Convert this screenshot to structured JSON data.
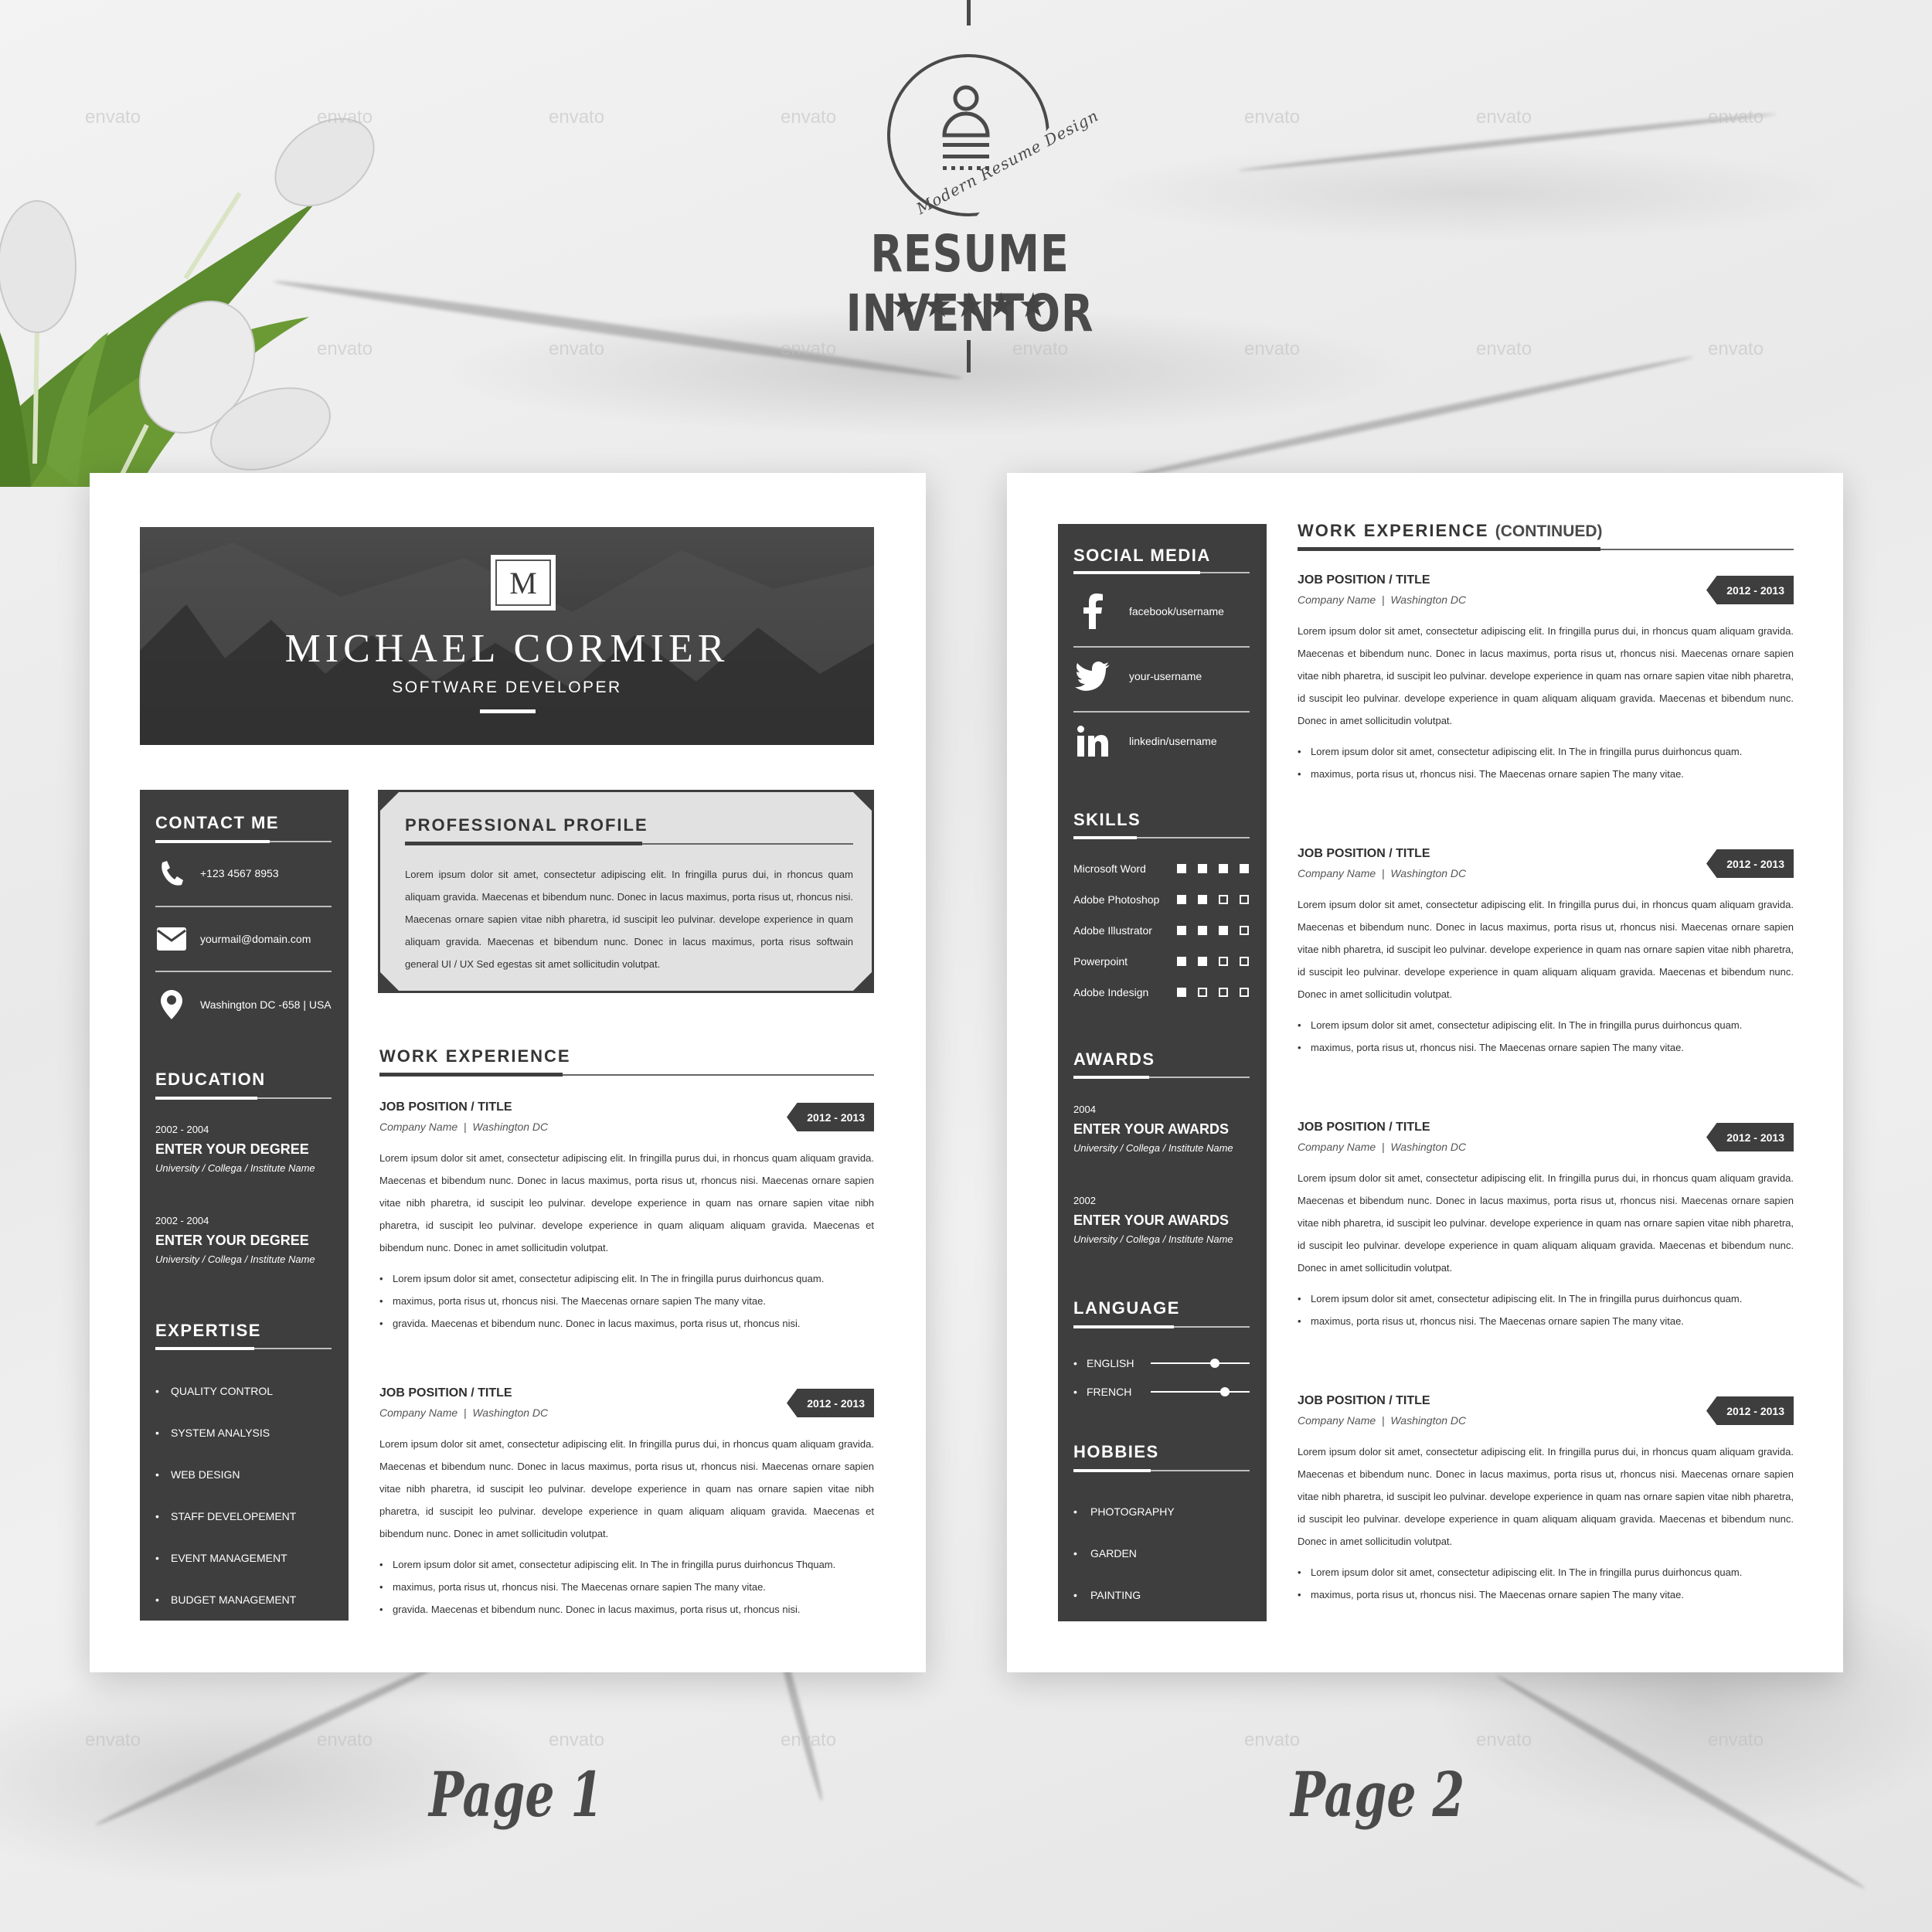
{
  "brand": {
    "tagline": "Modern Resume Design",
    "title": "RESUME INVENTOR",
    "rating_stars": 5,
    "stars_text": "★★★★★"
  },
  "watermark": "envato",
  "page1": {
    "header": {
      "monogram": "M",
      "name": "MICHAEL CORMIER",
      "role": "SOFTWARE DEVELOPER"
    },
    "contact": {
      "title": "CONTACT ME",
      "phone": "+123 4567 8953",
      "email": "yourmail@domain.com",
      "address": "Washington DC -658 | USA"
    },
    "education": {
      "title": "EDUCATION",
      "items": [
        {
          "years": "2002 - 2004",
          "degree": "ENTER YOUR DEGREE",
          "institution": "University / Collega / Institute Name"
        },
        {
          "years": "2002 - 2004",
          "degree": "ENTER YOUR DEGREE",
          "institution": "University / Collega / Institute Name"
        }
      ]
    },
    "expertise": {
      "title": "EXPERTISE",
      "items": [
        "QUALITY CONTROL",
        "SYSTEM ANALYSIS",
        "WEB DESIGN",
        "STAFF DEVELOPEMENT",
        "EVENT MANAGEMENT",
        "BUDGET MANAGEMENT"
      ]
    },
    "profile": {
      "title": "PROFESSIONAL PROFILE",
      "text": "Lorem ipsum dolor sit amet, consectetur adipiscing elit. In fringilla purus dui, in rhoncus quam aliquam gravida. Maecenas et bibendum nunc. Donec in lacus maximus, porta risus ut, rhoncus nisi. Maecenas ornare sapien vitae nibh pharetra, id suscipit leo pulvinar. develope experience in quam aliquam gravida. Maecenas et bibendum nunc. Donec in lacus maximus, porta risus softwain general UI / UX Sed egestas sit amet sollicitudin volutpat."
    },
    "work": {
      "title": "WORK EXPERIENCE",
      "jobs": [
        {
          "title": "JOB POSITION / TITLE",
          "company": "Company Name  |  Washington DC",
          "dates": "2012 - 2013",
          "description": "Lorem ipsum dolor sit amet, consectetur adipiscing elit. In fringilla purus dui, in rhoncus quam aliquam gravida. Maecenas et bibendum nunc. Donec in lacus maximus, porta risus ut, rhoncus nisi. Maecenas ornare sapien vitae nibh pharetra, id suscipit leo pulvinar. develope experience in quam nas ornare sapien vitae nibh pharetra, id suscipit leo pulvinar. develope experience in quam aliquam aliquam gravida. Maecenas et bibendum nunc. Donec in amet sollicitudin volutpat.",
          "bullets": [
            "Lorem ipsum dolor sit amet, consectetur adipiscing elit. In The in fringilla purus duirhoncus quam.",
            "maximus, porta risus ut, rhoncus nisi. The Maecenas ornare sapien The many vitae.",
            "gravida. Maecenas et bibendum nunc. Donec in lacus maximus, porta risus ut, rhoncus nisi."
          ]
        },
        {
          "title": "JOB POSITION / TITLE",
          "company": "Company Name  |  Washington DC",
          "dates": "2012 - 2013",
          "description": "Lorem ipsum dolor sit amet, consectetur adipiscing elit. In fringilla purus dui, in rhoncus quam aliquam gravida. Maecenas et bibendum nunc. Donec in lacus maximus, porta risus ut, rhoncus nisi. Maecenas ornare sapien vitae nibh pharetra, id suscipit leo pulvinar. develope experience in quam nas ornare sapien vitae nibh pharetra, id suscipit leo pulvinar. develope experience in quam aliquam aliquam gravida. Maecenas et bibendum nunc. Donec in amet sollicitudin volutpat.",
          "bullets": [
            "Lorem ipsum dolor sit amet, consectetur adipiscing elit. In The in fringilla purus duirhoncus Thquam.",
            "maximus, porta risus ut, rhoncus nisi. The Maecenas ornare sapien The many vitae.",
            "gravida. Maecenas et bibendum nunc. Donec in lacus maximus, porta risus ut, rhoncus nisi."
          ]
        }
      ]
    },
    "caption": "Page 1"
  },
  "page2": {
    "social": {
      "title": "SOCIAL MEDIA",
      "items": [
        {
          "icon": "facebook-icon",
          "label": "facebook/username"
        },
        {
          "icon": "twitter-icon",
          "label": "your-username"
        },
        {
          "icon": "linkedin-icon",
          "label": "linkedin/username"
        }
      ]
    },
    "skills": {
      "title": "SKILLS",
      "max": 4,
      "items": [
        {
          "name": "Microsoft Word",
          "level": 4
        },
        {
          "name": "Adobe Photoshop",
          "level": 2
        },
        {
          "name": "Adobe Illustrator",
          "level": 3
        },
        {
          "name": "Powerpoint",
          "level": 2
        },
        {
          "name": "Adobe Indesign",
          "level": 1
        }
      ]
    },
    "awards": {
      "title": "AWARDS",
      "items": [
        {
          "year": "2004",
          "name": "ENTER YOUR AWARDS",
          "institution": "University / Collega / Institute Name"
        },
        {
          "year": "2002",
          "name": "ENTER YOUR AWARDS",
          "institution": "University / Collega / Institute Name"
        }
      ]
    },
    "language": {
      "title": "LANGUAGE",
      "items": [
        {
          "name": "ENGLISH",
          "proficiency": 0.65
        },
        {
          "name": "FRENCH",
          "proficiency": 0.75
        }
      ]
    },
    "hobbies": {
      "title": "HOBBIES",
      "items": [
        "PHOTOGRAPHY",
        "GARDEN",
        "PAINTING"
      ]
    },
    "work": {
      "title": "WORK EXPERIENCE",
      "title_suffix": "(CONTINUED)",
      "jobs": [
        {
          "title": "JOB POSITION / TITLE",
          "company": "Company Name  |  Washington DC",
          "dates": "2012 - 2013",
          "description": "Lorem ipsum dolor sit amet, consectetur adipiscing elit. In fringilla purus dui, in rhoncus quam aliquam gravida. Maecenas et bibendum nunc. Donec in lacus maximus, porta risus ut, rhoncus nisi. Maecenas ornare sapien vitae nibh pharetra, id suscipit leo pulvinar. develope experience in quam nas ornare sapien vitae nibh pharetra, id suscipit leo pulvinar. develope experience in quam aliquam aliquam gravida. Maecenas et bibendum nunc. Donec in amet sollicitudin volutpat.",
          "bullets": [
            "Lorem ipsum dolor sit amet, consectetur adipiscing elit. In The in fringilla purus duirhoncus quam.",
            "maximus, porta risus ut, rhoncus nisi. The Maecenas ornare sapien The many vitae."
          ]
        },
        {
          "title": "JOB POSITION / TITLE",
          "company": "Company Name  |  Washington DC",
          "dates": "2012 - 2013",
          "description": "Lorem ipsum dolor sit amet, consectetur adipiscing elit. In fringilla purus dui, in rhoncus quam aliquam gravida. Maecenas et bibendum nunc. Donec in lacus maximus, porta risus ut, rhoncus nisi. Maecenas ornare sapien vitae nibh pharetra, id suscipit leo pulvinar. develope experience in quam nas ornare sapien vitae nibh pharetra, id suscipit leo pulvinar. develope experience in quam aliquam aliquam gravida. Maecenas et bibendum nunc. Donec in amet sollicitudin volutpat.",
          "bullets": [
            "Lorem ipsum dolor sit amet, consectetur adipiscing elit. In The in fringilla purus duirhoncus quam.",
            "maximus, porta risus ut, rhoncus nisi. The Maecenas ornare sapien The many vitae."
          ]
        },
        {
          "title": "JOB POSITION / TITLE",
          "company": "Company Name  |  Washington DC",
          "dates": "2012 - 2013",
          "description": "Lorem ipsum dolor sit amet, consectetur adipiscing elit. In fringilla purus dui, in rhoncus quam aliquam gravida. Maecenas et bibendum nunc. Donec in lacus maximus, porta risus ut, rhoncus nisi. Maecenas ornare sapien vitae nibh pharetra, id suscipit leo pulvinar. develope experience in quam nas ornare sapien vitae nibh pharetra, id suscipit leo pulvinar. develope experience in quam aliquam aliquam gravida. Maecenas et bibendum nunc. Donec in amet sollicitudin volutpat.",
          "bullets": [
            "Lorem ipsum dolor sit amet, consectetur adipiscing elit. In The in fringilla purus duirhoncus quam.",
            "maximus, porta risus ut, rhoncus nisi. The Maecenas ornare sapien The many vitae."
          ]
        },
        {
          "title": "JOB POSITION / TITLE",
          "company": "Company Name  |  Washington DC",
          "dates": "2012 - 2013",
          "description": "Lorem ipsum dolor sit amet, consectetur adipiscing elit. In fringilla purus dui, in rhoncus quam aliquam gravida. Maecenas et bibendum nunc. Donec in lacus maximus, porta risus ut, rhoncus nisi. Maecenas ornare sapien vitae nibh pharetra, id suscipit leo pulvinar. develope experience in quam nas ornare sapien vitae nibh pharetra, id suscipit leo pulvinar. develope experience in quam aliquam aliquam gravida. Maecenas et bibendum nunc. Donec in amet sollicitudin volutpat.",
          "bullets": [
            "Lorem ipsum dolor sit amet, consectetur adipiscing elit. In The in fringilla purus duirhoncus quam.",
            "maximus, porta risus ut, rhoncus nisi. The Maecenas ornare sapien The many vitae."
          ]
        }
      ]
    },
    "caption": "Page 2"
  }
}
